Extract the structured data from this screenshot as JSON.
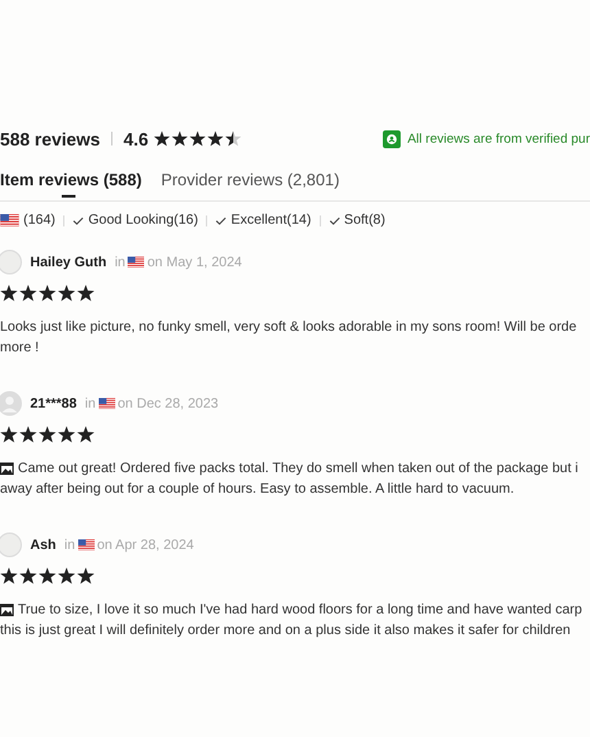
{
  "summary": {
    "count": "588 reviews",
    "rating": "4.6",
    "stars": 4.5,
    "verified": "All reviews are from verified pur"
  },
  "tabs": [
    {
      "label": "Item reviews (588)",
      "selected": true
    },
    {
      "label": "Provider reviews (2,801)",
      "selected": false
    }
  ],
  "filters": [
    {
      "kind": "flag",
      "label": "(164)"
    },
    {
      "kind": "check",
      "label": "Good Looking(16)"
    },
    {
      "kind": "check",
      "label": "Excellent(14)"
    },
    {
      "kind": "check",
      "label": "Soft(8)"
    }
  ],
  "reviews": [
    {
      "kind": "blank",
      "name": "Hailey Guth",
      "in": "in",
      "date": "on May 1, 2024",
      "stars": 5,
      "has_photo": false,
      "lines": [
        "Looks just like picture, no funky smell, very soft & looks adorable in my sons room! Will be orde",
        "more !"
      ]
    },
    {
      "kind": "silhouette",
      "name": "21***88",
      "in": "in",
      "date": "on Dec 28, 2023",
      "stars": 5,
      "has_photo": true,
      "lines": [
        "Came out great! Ordered five packs total. They do smell when taken out of the package but i",
        "away after being out for a couple of hours. Easy to assemble. A little hard to vacuum."
      ]
    },
    {
      "kind": "blank",
      "name": "Ash",
      "in": "in",
      "date": "on Apr 28, 2024",
      "stars": 5,
      "has_photo": true,
      "lines": [
        "True to size, I love it so much I've had hard wood floors for a long time and have wanted carp",
        "this is just great I will definitely order more and on a plus side it also makes it safer for children"
      ]
    }
  ]
}
